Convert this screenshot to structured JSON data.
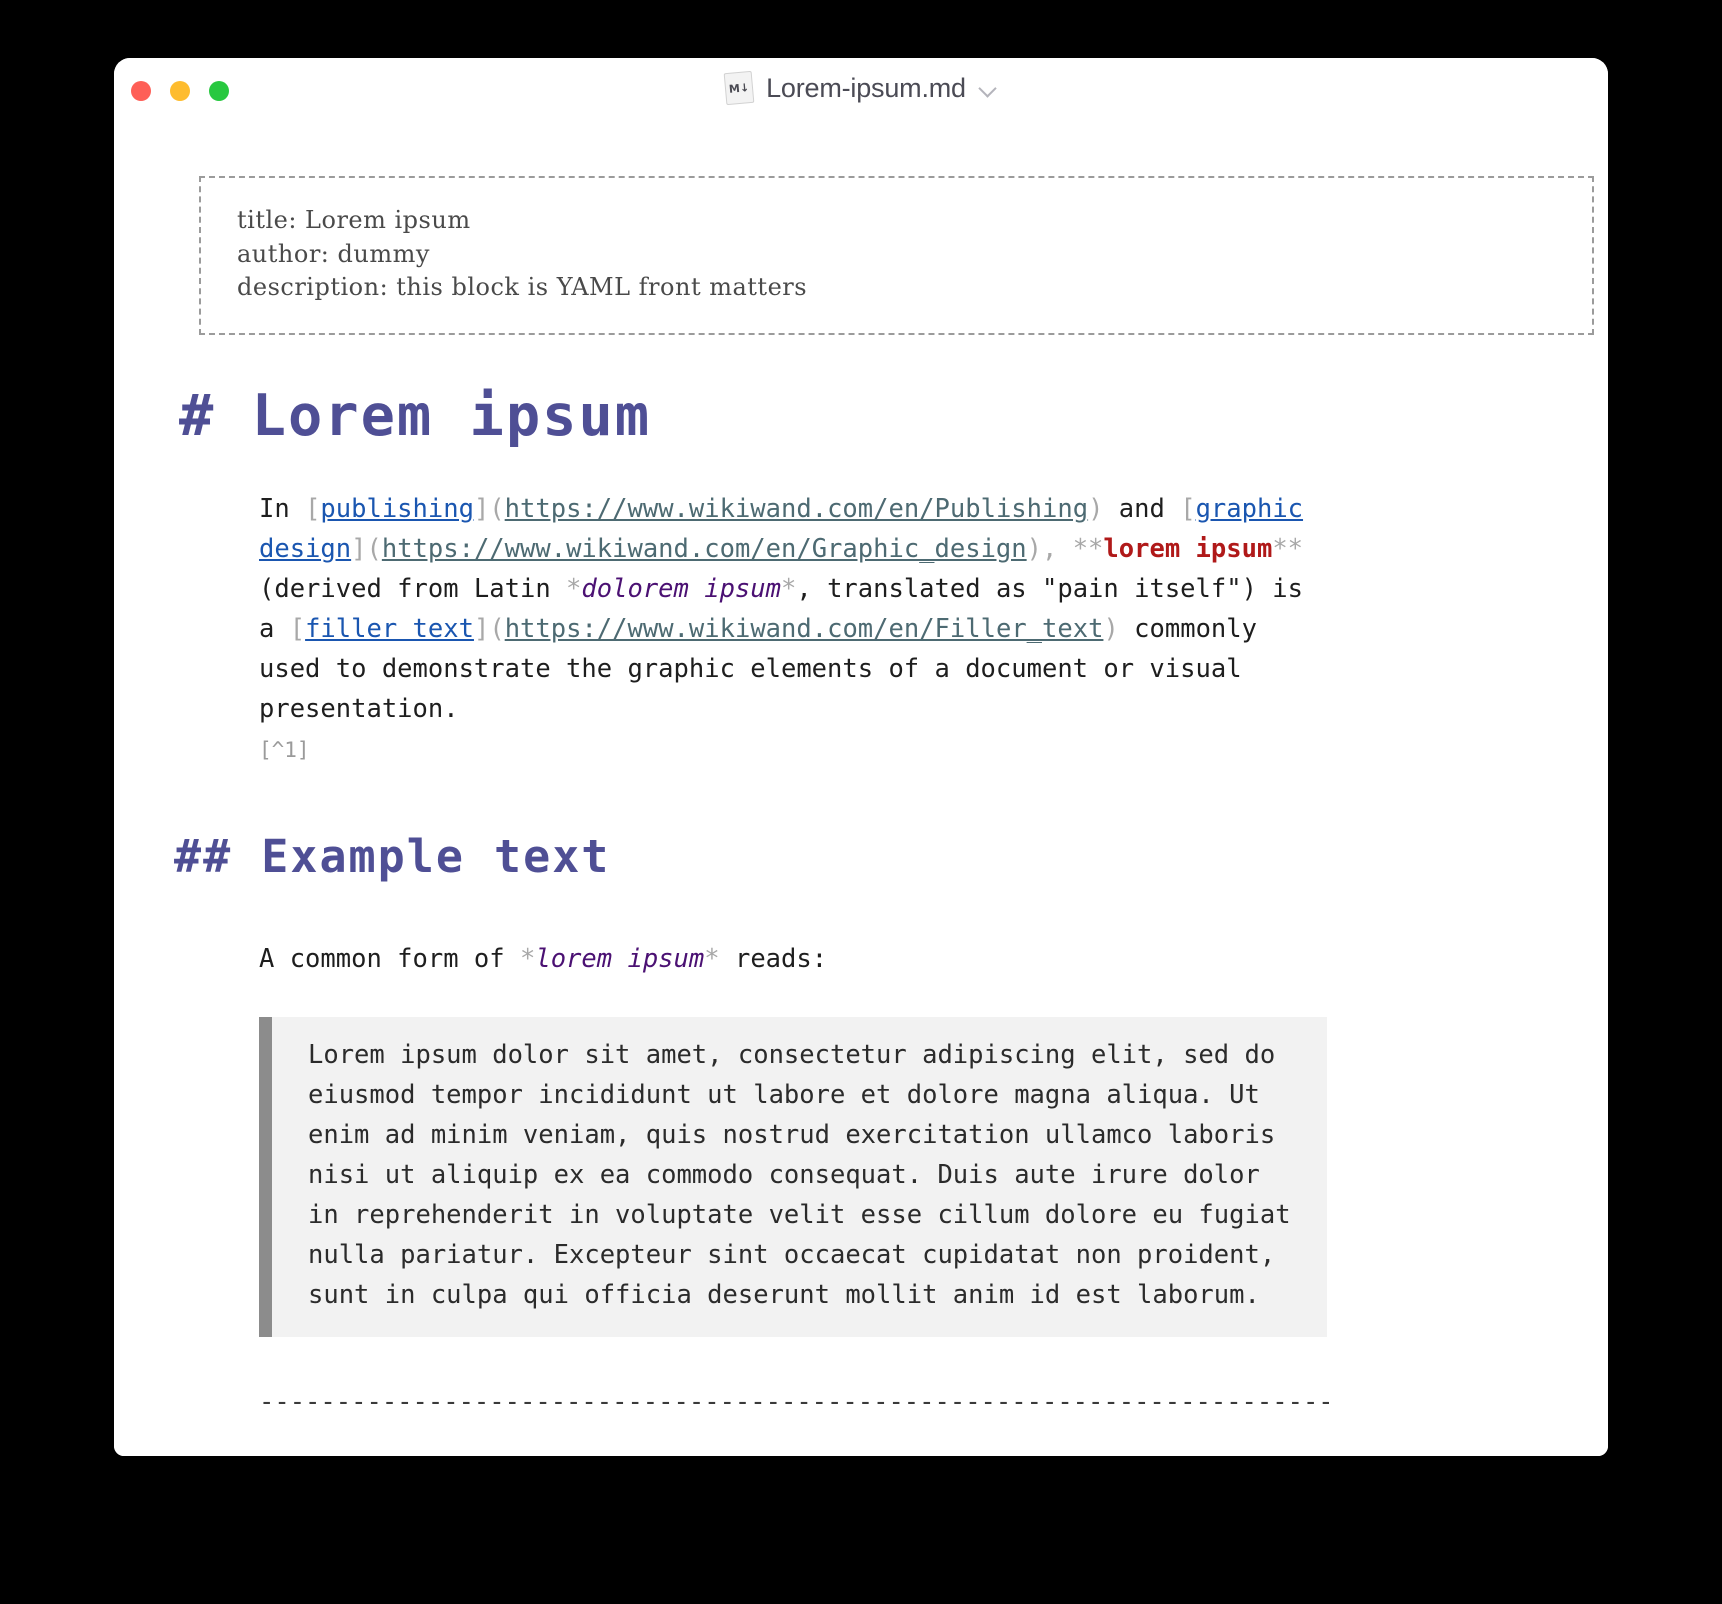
{
  "window": {
    "title": "Lorem-ipsum.md",
    "file_icon_label": "M↓",
    "traffic_lights": [
      "close",
      "minimize",
      "zoom"
    ],
    "colors": {
      "close": "#fe5f57",
      "minimize": "#febc2e",
      "zoom": "#28c840",
      "heading": "#4f4f95",
      "link_text": "#1a56b0",
      "url": "#4d6a72",
      "strong": "#b01919",
      "emphasis": "#4b1173",
      "punctuation": "#a8a8a8"
    }
  },
  "document": {
    "frontmatter": [
      "title: Lorem ipsum",
      "author: dummy",
      "description: this block is YAML front matters"
    ],
    "h1": "# Lorem ipsum",
    "h2": "## Example text",
    "paragraph1": {
      "t1": "In ",
      "b1": "[",
      "link1": "publishing",
      "b2": "](",
      "url1": "https://www.wikiwand.com/en/Publishing",
      "b3": ") ",
      "t2": "and ",
      "b4": "[",
      "link2": "graphic design",
      "b5": "](",
      "url2": "https://www.wikiwand.com/en/Graphic_design",
      "b6": "), ",
      "ast1": "**",
      "strong1": "lorem ipsum",
      "ast2": "**",
      "t3": " (derived from Latin ",
      "ast3": "*",
      "em1": "dolorem ipsum",
      "ast4": "*",
      "t4": ", translated as \"pain itself\") is a ",
      "b7": "[",
      "link3": "filler text",
      "b8": "](",
      "url3": "https://www.wikiwand.com/en/Filler_text",
      "b9": ") ",
      "t5": "commonly used to demonstrate the graphic elements of a document or visual presentation.",
      "footnote": "[^1]"
    },
    "paragraph2": {
      "t1": "A common form of ",
      "ast1": "*",
      "em1": "lorem ipsum",
      "ast2": "*",
      "t2": " reads:"
    },
    "blockquote": "Lorem ipsum dolor sit amet, consectetur adipiscing elit, sed do eiusmod tempor incididunt ut labore et dolore magna aliqua. Ut enim ad minim veniam, quis nostrud exercitation ullamco laboris nisi ut aliquip ex ea commodo consequat. Duis aute irure dolor in reprehenderit in voluptate velit esse cillum dolore eu fugiat nulla pariatur. Excepteur sint occaecat cupidatat non proident, sunt in culpa qui officia deserunt mollit anim id est laborum.",
    "horizontal_rule": "--------------------------------------------------------------------------------"
  }
}
